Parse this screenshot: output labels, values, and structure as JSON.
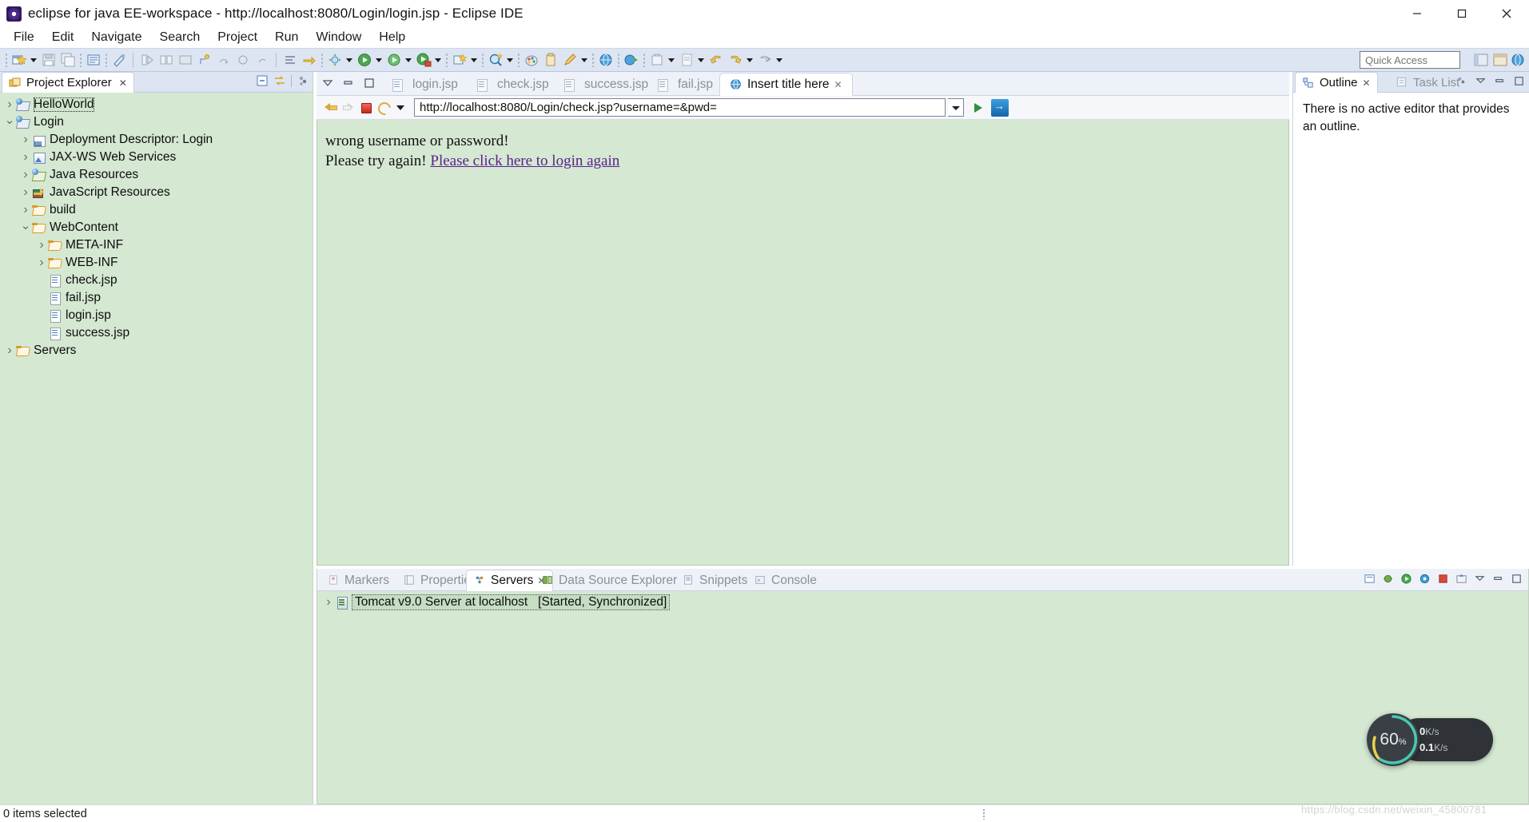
{
  "window": {
    "title": "eclipse for java EE-workspace - http://localhost:8080/Login/login.jsp - Eclipse IDE",
    "app_icon": "eclipse-icon",
    "minimize_label": "─",
    "maximize_label": "❐",
    "close_label": "✕"
  },
  "menubar": {
    "items": [
      {
        "label": "File"
      },
      {
        "label": "Edit"
      },
      {
        "label": "Navigate"
      },
      {
        "label": "Search"
      },
      {
        "label": "Project"
      },
      {
        "label": "Run"
      },
      {
        "label": "Window"
      },
      {
        "label": "Help"
      }
    ]
  },
  "toolbar": {
    "quick_access_placeholder": "Quick Access",
    "quick_access_value": ""
  },
  "explorer": {
    "tab_label": "Project Explorer",
    "tab_close": "✕",
    "tree": [
      {
        "label": "HelloWorld",
        "indent": 0,
        "twisty": "closed",
        "icon": "web-project-icon",
        "selected": true
      },
      {
        "label": "Login",
        "indent": 0,
        "twisty": "open",
        "icon": "web-project-icon",
        "selected": false
      },
      {
        "label": "Deployment Descriptor: Login",
        "indent": 1,
        "twisty": "closed",
        "icon": "deployment-descriptor-icon",
        "selected": false
      },
      {
        "label": "JAX-WS Web Services",
        "indent": 1,
        "twisty": "closed",
        "icon": "web-service-icon",
        "selected": false
      },
      {
        "label": "Java Resources",
        "indent": 1,
        "twisty": "closed",
        "icon": "java-resources-icon",
        "selected": false
      },
      {
        "label": "JavaScript Resources",
        "indent": 1,
        "twisty": "closed",
        "icon": "javascript-resources-icon",
        "selected": false
      },
      {
        "label": "build",
        "indent": 1,
        "twisty": "closed",
        "icon": "folder-icon",
        "selected": false
      },
      {
        "label": "WebContent",
        "indent": 1,
        "twisty": "open",
        "icon": "folder-icon",
        "selected": false
      },
      {
        "label": "META-INF",
        "indent": 2,
        "twisty": "closed",
        "icon": "folder-icon",
        "selected": false
      },
      {
        "label": "WEB-INF",
        "indent": 2,
        "twisty": "closed",
        "icon": "folder-icon",
        "selected": false
      },
      {
        "label": "check.jsp",
        "indent": 2,
        "twisty": "none",
        "icon": "jsp-file-icon",
        "selected": false
      },
      {
        "label": "fail.jsp",
        "indent": 2,
        "twisty": "none",
        "icon": "jsp-file-icon",
        "selected": false
      },
      {
        "label": "login.jsp",
        "indent": 2,
        "twisty": "none",
        "icon": "jsp-file-icon",
        "selected": false
      },
      {
        "label": "success.jsp",
        "indent": 2,
        "twisty": "none",
        "icon": "jsp-file-icon",
        "selected": false
      },
      {
        "label": "Servers",
        "indent": 0,
        "twisty": "closed",
        "icon": "folder-icon",
        "selected": false
      }
    ]
  },
  "editor": {
    "tabs": [
      {
        "label": "login.jsp",
        "icon": "jsp-file-icon",
        "active": false,
        "close": ""
      },
      {
        "label": "check.jsp",
        "icon": "jsp-file-icon",
        "active": false,
        "close": ""
      },
      {
        "label": "success.jsp",
        "icon": "jsp-file-icon",
        "active": false,
        "close": ""
      },
      {
        "label": "fail.jsp",
        "icon": "jsp-file-icon",
        "active": false,
        "close": ""
      },
      {
        "label": "Insert title here",
        "icon": "web-browser-icon",
        "active": true,
        "close": "✕"
      }
    ],
    "browser": {
      "url": "http://localhost:8080/Login/check.jsp?username=&pwd=",
      "back_icon": "back-arrow-icon",
      "forward_icon": "forward-arrow-icon",
      "stop_icon": "stop-icon",
      "refresh_icon": "refresh-icon",
      "dropdown_icon": "chevron-down-icon",
      "go_icon": "go-arrow-icon",
      "bookmark_icon": "open-external-browser-icon"
    },
    "page": {
      "line1": "wrong username or password!",
      "line2_prefix": "Please try again!",
      "line2_link": "Please click here to login again"
    }
  },
  "outline": {
    "tabs": [
      {
        "label": "Outline",
        "active": true,
        "close": "✕",
        "icon": "outline-icon"
      },
      {
        "label": "Task List",
        "active": false,
        "close": "",
        "icon": "task-list-icon"
      }
    ],
    "empty_message": "There is no active editor that provides an outline."
  },
  "bottom_panel": {
    "tabs": [
      {
        "label": "Markers",
        "icon": "markers-icon",
        "active": false,
        "close": ""
      },
      {
        "label": "Properties",
        "icon": "properties-icon",
        "active": false,
        "close": ""
      },
      {
        "label": "Servers",
        "icon": "servers-icon",
        "active": true,
        "close": "✕"
      },
      {
        "label": "Data Source Explorer",
        "icon": "data-source-icon",
        "active": false,
        "close": ""
      },
      {
        "label": "Snippets",
        "icon": "snippets-icon",
        "active": false,
        "close": ""
      },
      {
        "label": "Console",
        "icon": "console-icon",
        "active": false,
        "close": ""
      }
    ],
    "server_row": {
      "name": "Tomcat v9.0 Server at localhost",
      "status": "[Started, Synchronized]",
      "twisty": "closed",
      "icon": "server-icon"
    }
  },
  "statusbar": {
    "text": "0 items selected"
  },
  "net_widget": {
    "percent": "60",
    "percent_unit": "%",
    "upload": "0",
    "upload_unit": "K/s",
    "download": "0.1",
    "download_unit": "K/s",
    "upload_icon": "arrow-up-icon",
    "download_icon": "arrow-down-icon",
    "ring_color": "#49c9b0",
    "ring_color2": "#e8d24a"
  },
  "watermark": {
    "text": "https://blog.csdn.net/weixin_45800781"
  }
}
